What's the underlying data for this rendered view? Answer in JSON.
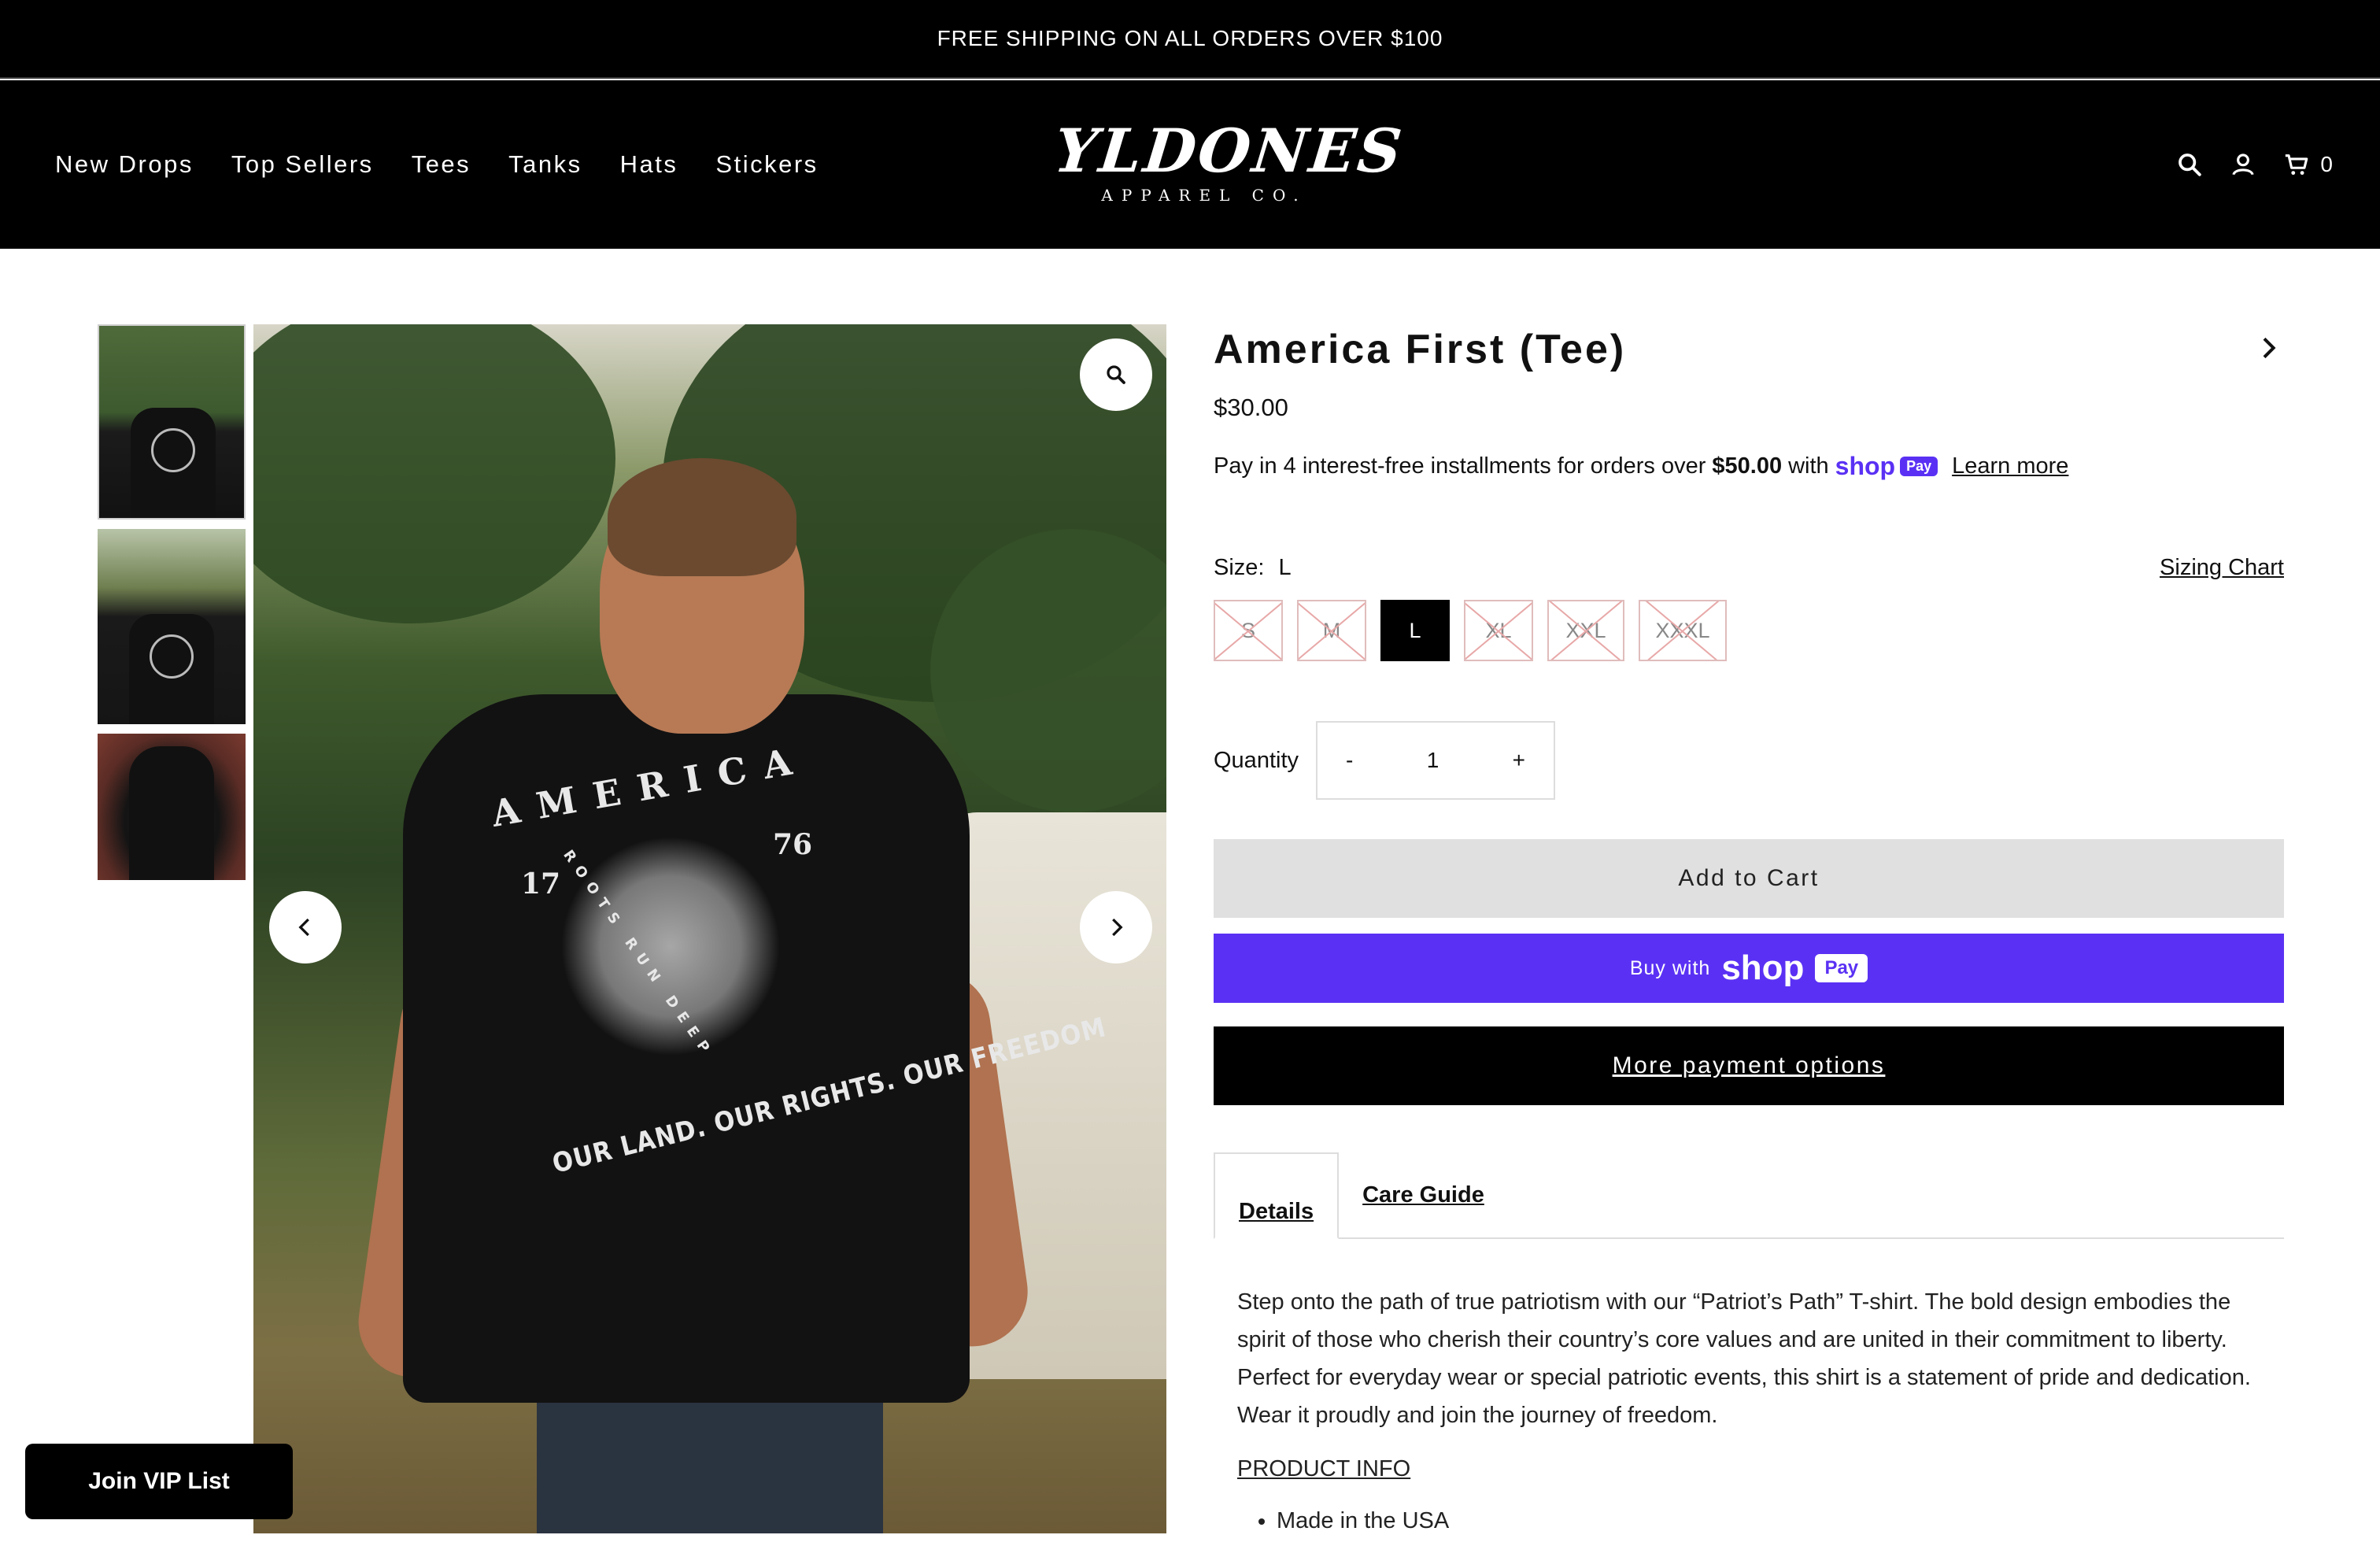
{
  "announcement": {
    "text": "FREE SHIPPING ON ALL ORDERS OVER $100"
  },
  "nav": {
    "items": [
      "New Drops",
      "Top Sellers",
      "Tees",
      "Tanks",
      "Hats",
      "Stickers"
    ]
  },
  "logo": {
    "main": "YLDONES",
    "sub": "APPAREL CO."
  },
  "header": {
    "cart_count": "0",
    "icons": [
      "search-icon",
      "account-icon",
      "cart-icon"
    ]
  },
  "gallery": {
    "print_america": "AMERICA",
    "print_17": "17",
    "print_76": "76",
    "print_roots": "ROOTS RUN DEEP",
    "print_slogan": "OUR LAND. OUR RIGHTS. OUR FREEDOM",
    "zoom_icon": "zoom-icon",
    "prev_icon": "chevron-left-icon",
    "next_icon": "chevron-right-icon"
  },
  "product": {
    "title": "America First (Tee)",
    "price": "$30.00",
    "installments_prefix": "Pay in 4 interest-free installments for orders over",
    "installments_amount": "$50.00",
    "installments_with": "with",
    "shop_word": "shop",
    "shop_pay_badge": "Pay",
    "learn_more": "Learn more",
    "size_label": "Size:",
    "size_value": "L",
    "sizing_chart": "Sizing Chart",
    "sizes": [
      {
        "label": "S",
        "available": false
      },
      {
        "label": "M",
        "available": false
      },
      {
        "label": "L",
        "available": true,
        "selected": true
      },
      {
        "label": "XL",
        "available": false
      },
      {
        "label": "XXL",
        "available": false
      },
      {
        "label": "XXXL",
        "available": false
      }
    ],
    "quantity_label": "Quantity",
    "qty_minus": "-",
    "qty_value": "1",
    "qty_plus": "+",
    "add_to_cart": "Add to Cart",
    "buy_with": "Buy with",
    "buy_shop": "shop",
    "buy_pay": "Pay",
    "more_payment": "More payment options"
  },
  "tabs": {
    "details": "Details",
    "care": "Care Guide",
    "description": "Step onto the path of true patriotism with our “Patriot’s Path” T-shirt. The bold design embodies the spirit of those who cherish their country’s core values and are united in their commitment to liberty. Perfect for everyday wear or special patriotic events, this shirt is a statement of pride and dedication. Wear it proudly and join the journey of freedom.",
    "product_info": "PRODUCT INFO",
    "bullets": [
      "Made in the USA"
    ]
  },
  "vip": {
    "label": "Join VIP List"
  },
  "colors": {
    "shop_purple": "#5a31f4",
    "black": "#000000",
    "cart_gray": "#e0e0e0"
  }
}
